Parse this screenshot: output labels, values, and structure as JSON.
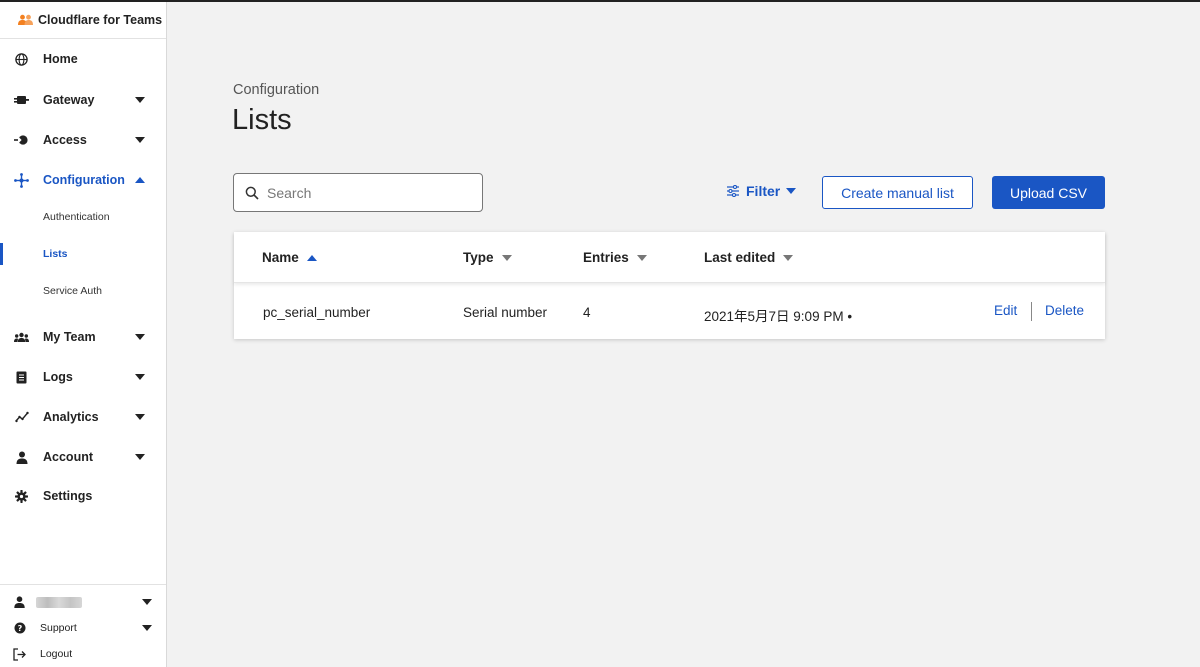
{
  "app": {
    "title": "Cloudflare for Teams",
    "accent": "#1a56c4",
    "brand_color": "#f38020"
  },
  "sidebar": {
    "items": [
      {
        "label": "Home",
        "icon": "globe-icon"
      },
      {
        "label": "Gateway",
        "icon": "gateway-icon"
      },
      {
        "label": "Access",
        "icon": "access-icon"
      },
      {
        "label": "Configuration",
        "icon": "configuration-icon"
      },
      {
        "label": "My Team",
        "icon": "team-icon"
      },
      {
        "label": "Logs",
        "icon": "logs-icon"
      },
      {
        "label": "Analytics",
        "icon": "analytics-icon"
      },
      {
        "label": "Account",
        "icon": "account-icon"
      },
      {
        "label": "Settings",
        "icon": "gear-icon"
      }
    ],
    "subitems": [
      {
        "label": "Authentication"
      },
      {
        "label": "Lists"
      },
      {
        "label": "Service Auth"
      }
    ],
    "bottom": {
      "support_label": "Support",
      "logout_label": "Logout"
    }
  },
  "page": {
    "breadcrumb": "Configuration",
    "title": "Lists"
  },
  "toolbar": {
    "search_placeholder": "Search",
    "filter_label": "Filter",
    "create_label": "Create manual list",
    "upload_label": "Upload CSV"
  },
  "table": {
    "columns": [
      "Name",
      "Type",
      "Entries",
      "Last edited"
    ],
    "rows": [
      {
        "name": "pc_serial_number",
        "type": "Serial number",
        "entries": "4",
        "last_edited": "2021年5月7日 9:09 PM •",
        "edit_label": "Edit",
        "delete_label": "Delete"
      }
    ]
  }
}
